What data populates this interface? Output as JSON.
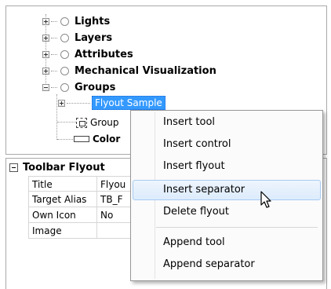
{
  "tree": {
    "items": [
      {
        "label": "Lights"
      },
      {
        "label": "Layers"
      },
      {
        "label": "Attributes"
      },
      {
        "label": "Mechanical Visualization"
      },
      {
        "label": "Groups"
      }
    ],
    "selected_label": "Flyout Sample",
    "group_label": "Group",
    "color_label": "Color"
  },
  "properties": {
    "title": "Toolbar Flyout",
    "rows": [
      {
        "name": "Title",
        "value": "Flyou"
      },
      {
        "name": "Target Alias",
        "value": "TB_F"
      },
      {
        "name": "Own Icon",
        "value": "No"
      },
      {
        "name": "Image",
        "value": ""
      }
    ]
  },
  "context_menu": {
    "items": [
      {
        "label": "Insert tool"
      },
      {
        "label": "Insert control"
      },
      {
        "label": "Insert flyout"
      },
      {
        "label": "Insert separator"
      },
      {
        "label": "Delete flyout"
      },
      {
        "label": "Append tool"
      },
      {
        "label": "Append separator"
      }
    ],
    "hovered": "Insert separator"
  },
  "colors": {
    "selection": "#3399ff",
    "menu_hover": "#dcebfc",
    "border": "#a9a9a9"
  }
}
